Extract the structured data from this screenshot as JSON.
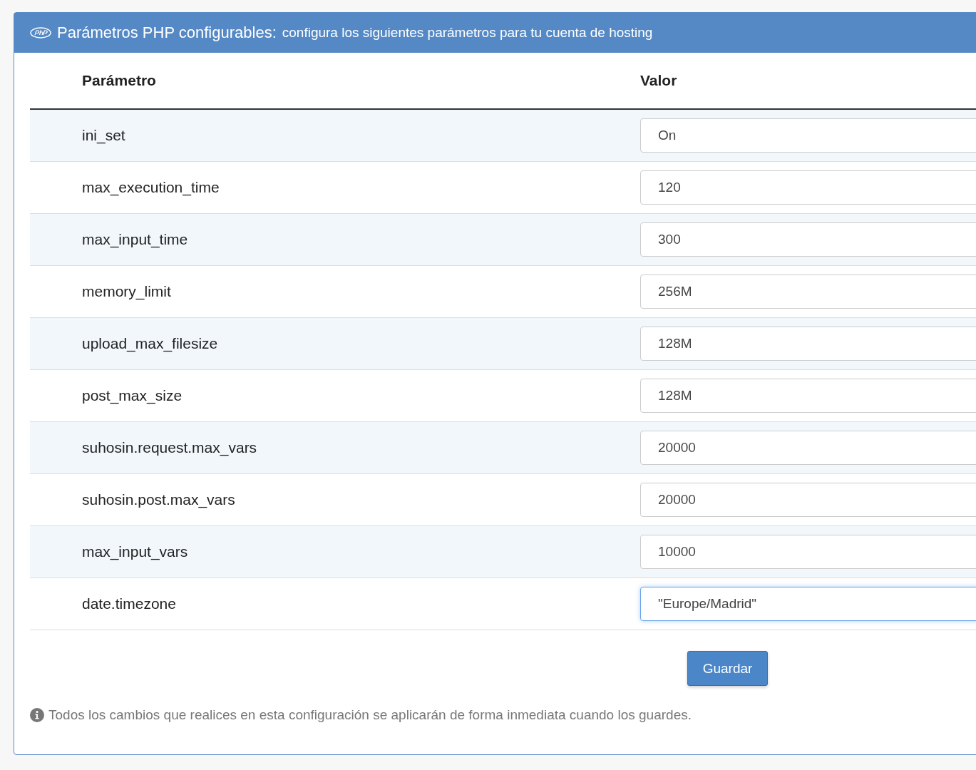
{
  "panel": {
    "title": "Parámetros PHP configurables:",
    "subtitle": "configura los siguientes parámetros para tu cuenta de hosting"
  },
  "table": {
    "columns": [
      "Parámetro",
      "Valor"
    ],
    "rows": [
      {
        "name": "ini_set",
        "value": "On",
        "focused": false
      },
      {
        "name": "max_execution_time",
        "value": "120",
        "focused": false
      },
      {
        "name": "max_input_time",
        "value": "300",
        "focused": false
      },
      {
        "name": "memory_limit",
        "value": "256M",
        "focused": false
      },
      {
        "name": "upload_max_filesize",
        "value": "128M",
        "focused": false
      },
      {
        "name": "post_max_size",
        "value": "128M",
        "focused": false
      },
      {
        "name": "suhosin.request.max_vars",
        "value": "20000",
        "focused": false
      },
      {
        "name": "suhosin.post.max_vars",
        "value": "20000",
        "focused": false
      },
      {
        "name": "max_input_vars",
        "value": "10000",
        "focused": false
      },
      {
        "name": "date.timezone",
        "value": "\"Europe/Madrid\"",
        "focused": true
      }
    ]
  },
  "save_button": "Guardar",
  "note": "Todos los cambios que realices en esta configuración se aplicarán de forma inmediata cuando los guardes."
}
